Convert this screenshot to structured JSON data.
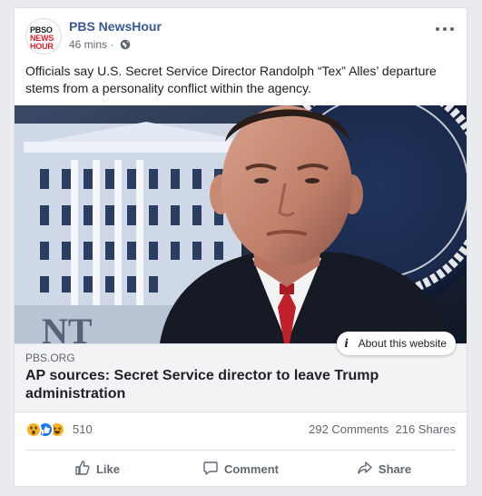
{
  "post": {
    "page_name": "PBS NewsHour",
    "avatar_logo": [
      "PBSO",
      "NEWS",
      "HOUR"
    ],
    "time": "46 mins",
    "separator": "·",
    "privacy_icon": "globe-icon",
    "text": "Officials say U.S. Secret Service Director Randolph “Tex” Alles’ departure stems from a personality conflict within the agency."
  },
  "link": {
    "domain": "PBS.ORG",
    "title": "AP sources: Secret Service director to leave Trump administration",
    "about_label": "About this website",
    "about_icon": "i"
  },
  "stats": {
    "reaction_count": "510",
    "comments": "292 Comments",
    "shares": "216 Shares",
    "reaction_icons": [
      "wow",
      "like",
      "haha"
    ]
  },
  "actions": [
    {
      "label": "Like",
      "icon": "thumbs-up-icon"
    },
    {
      "label": "Comment",
      "icon": "comment-icon"
    },
    {
      "label": "Share",
      "icon": "share-icon"
    }
  ],
  "colors": {
    "link_blue": "#385898",
    "pbs_red": "#e4202b",
    "like_blue": "#1877f2",
    "reaction_yellow": "#f7b125"
  }
}
